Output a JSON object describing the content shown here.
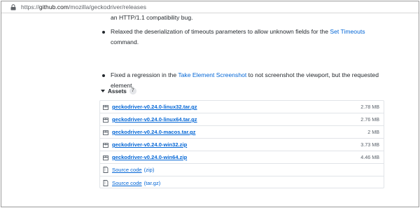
{
  "browser": {
    "url_prefix": "https://",
    "url_host": "github.com",
    "url_path": "/mozilla/geckodriver/releases"
  },
  "release_notes": {
    "top_fragment": "an HTTP/1.1 compatibility bug.",
    "item1": {
      "text_before": "Relaxed the deserialization of timeouts parameters to allow unknown fields for the ",
      "link": "Set Timeouts",
      "text_after": " command."
    },
    "item2": {
      "text_before": "Fixed a regression in the ",
      "link": "Take Element Screenshot",
      "text_after": " to not screenshot the viewport, but the requested element."
    }
  },
  "assets": {
    "title": "Assets",
    "count": "7",
    "files": [
      {
        "name": "geckodriver-v0.24.0-linux32.tar.gz",
        "size": "2.78 MB",
        "icon": "package-icon"
      },
      {
        "name": "geckodriver-v0.24.0-linux64.tar.gz",
        "size": "2.76 MB",
        "icon": "package-icon"
      },
      {
        "name": "geckodriver-v0.24.0-macos.tar.gz",
        "size": "2 MB",
        "icon": "package-icon"
      },
      {
        "name": "geckodriver-v0.24.0-win32.zip",
        "size": "3.73 MB",
        "icon": "package-icon"
      },
      {
        "name": "geckodriver-v0.24.0-win64.zip",
        "size": "4.46 MB",
        "icon": "package-icon"
      }
    ],
    "sources": [
      {
        "name": "Source code",
        "suffix": "(zip)",
        "icon": "file-zip-icon"
      },
      {
        "name": "Source code",
        "suffix": "(tar.gz)",
        "icon": "file-zip-icon"
      }
    ]
  },
  "colors": {
    "link": "#0366d6",
    "text": "#24292e",
    "muted": "#586069",
    "border": "#e1e4e8"
  }
}
